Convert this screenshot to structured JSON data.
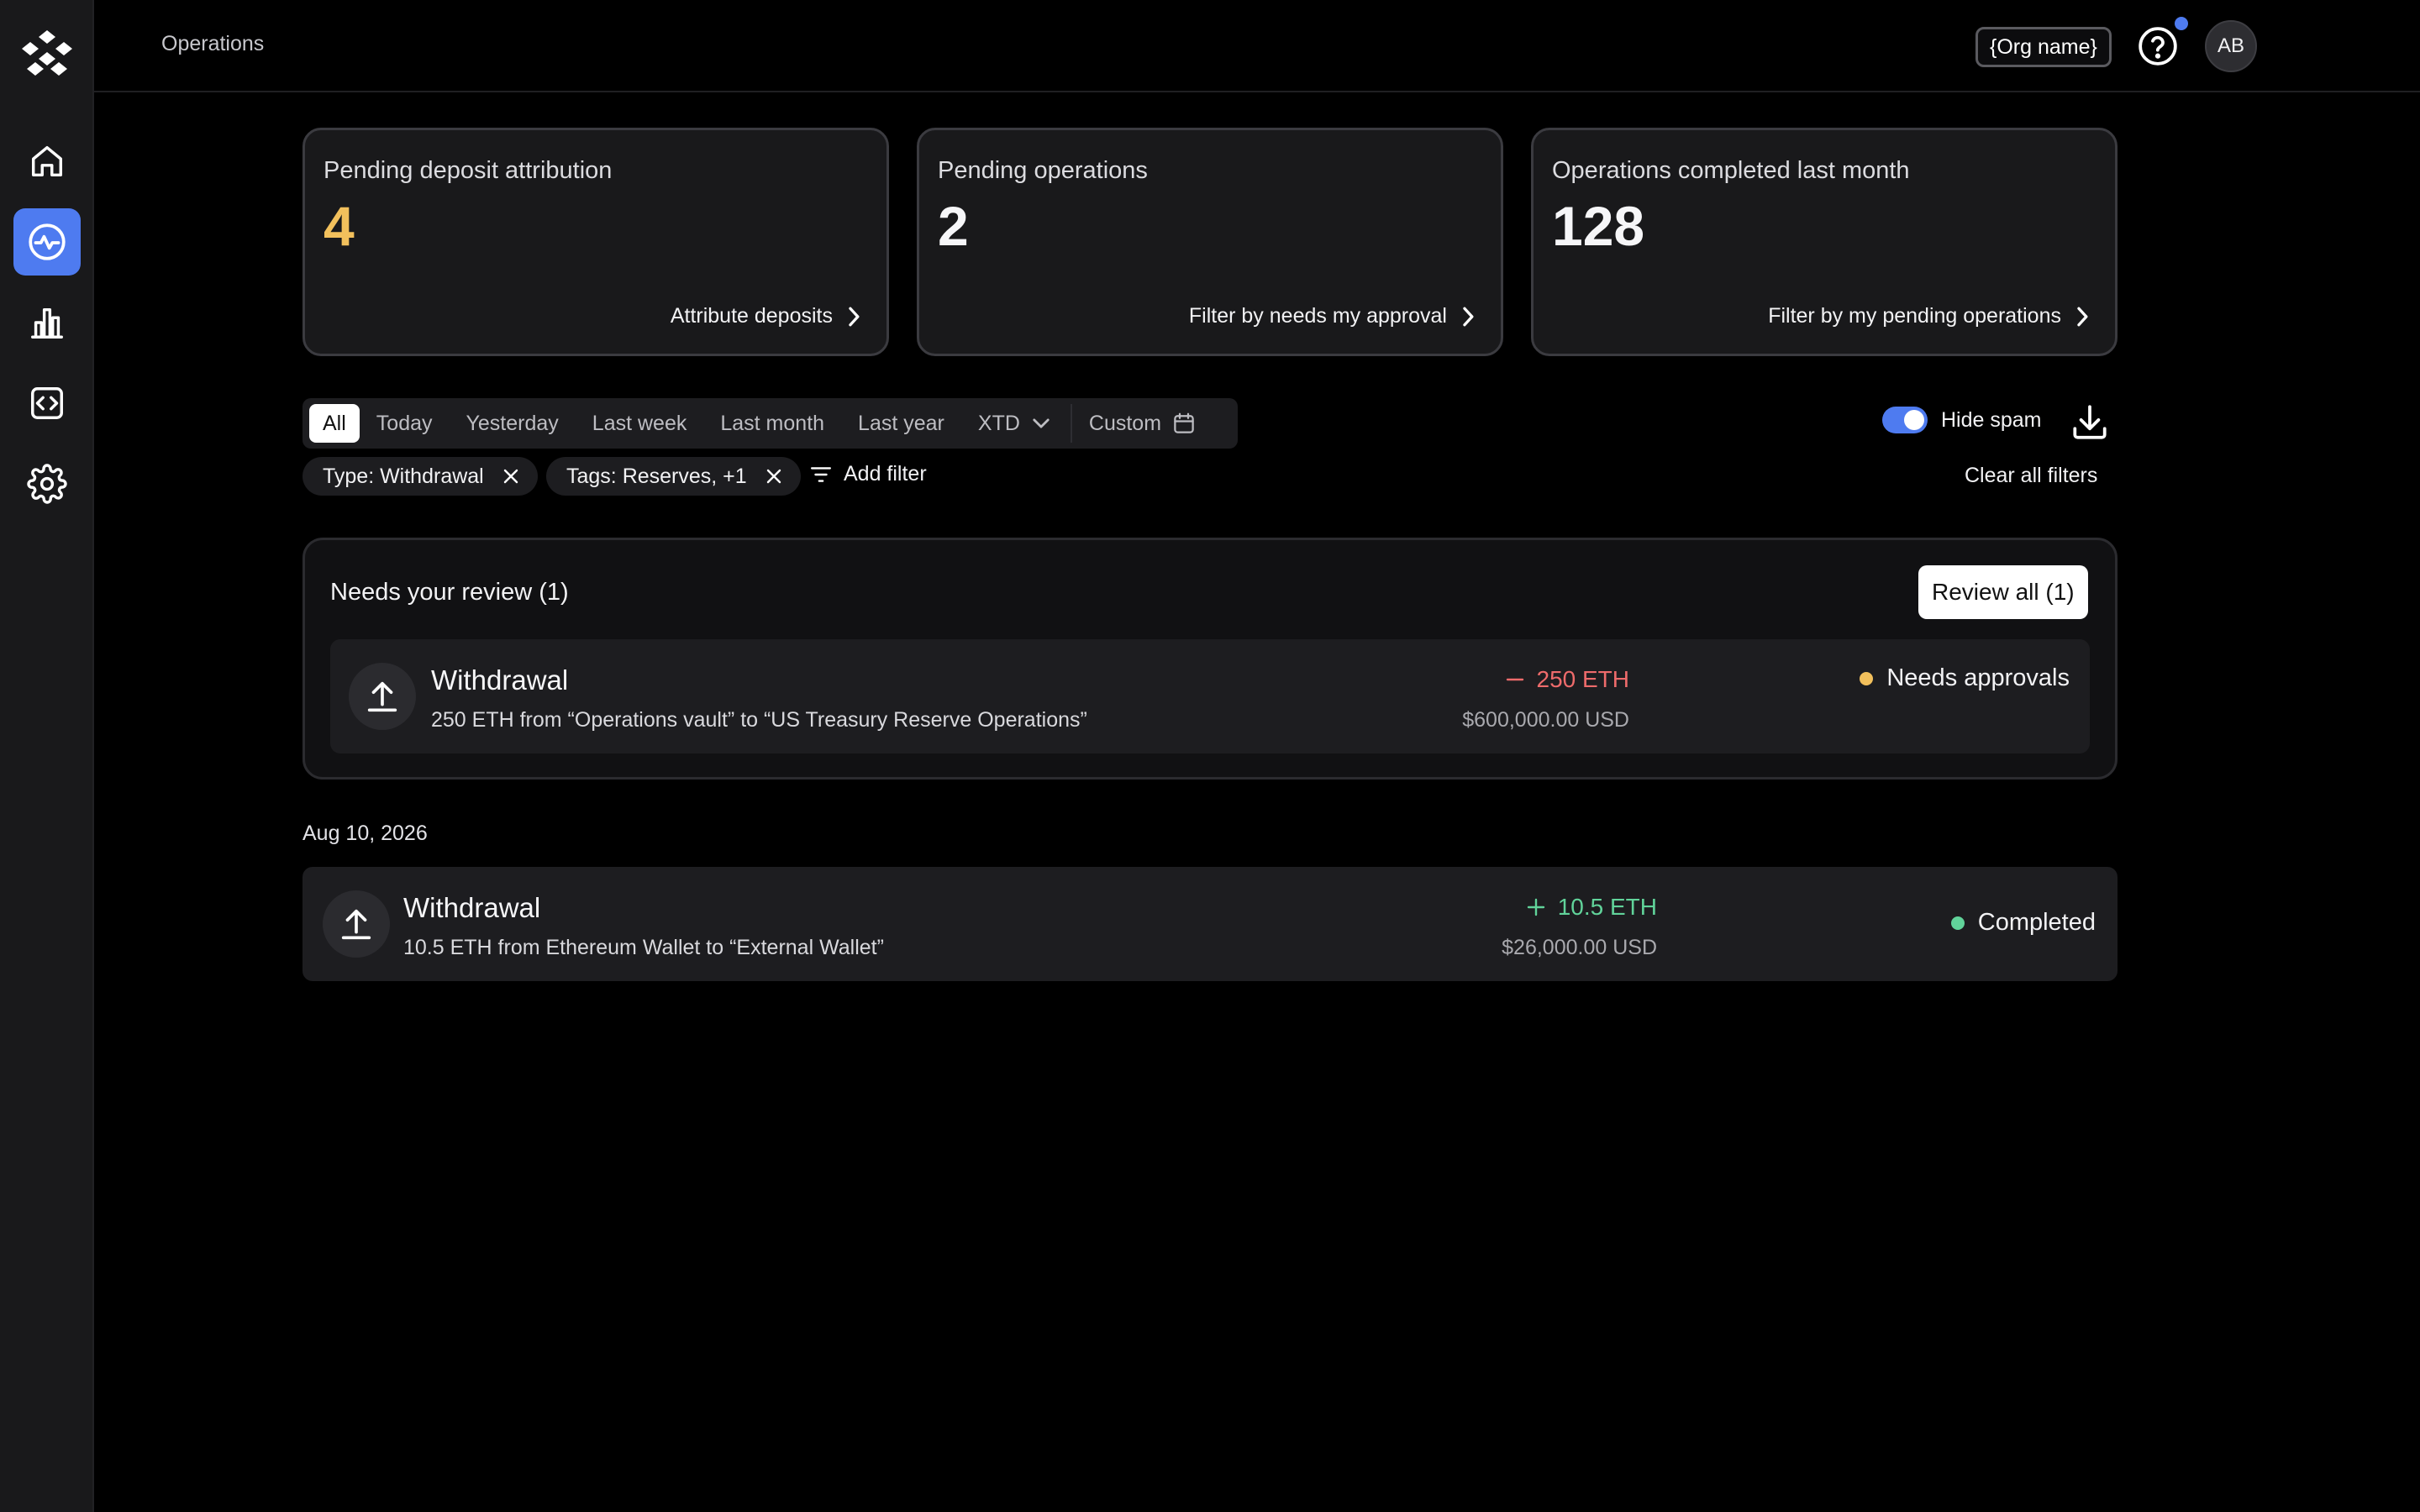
{
  "header": {
    "page_title": "Operations",
    "org_name": "{Org name}",
    "avatar_initials": "AB"
  },
  "sidebar": {
    "items": [
      {
        "name": "home",
        "icon": "home-icon",
        "active": false
      },
      {
        "name": "operations",
        "icon": "activity-icon",
        "active": true
      },
      {
        "name": "analytics",
        "icon": "bar-chart-icon",
        "active": false
      },
      {
        "name": "developer",
        "icon": "code-icon",
        "active": false
      },
      {
        "name": "settings",
        "icon": "gear-icon",
        "active": false
      }
    ]
  },
  "stats": [
    {
      "label": "Pending deposit attribution",
      "value": "4",
      "action": "Attribute deposits"
    },
    {
      "label": "Pending operations",
      "value": "2",
      "action": "Filter by needs my approval"
    },
    {
      "label": "Operations completed last month",
      "value": "128",
      "action": "Filter by my pending operations"
    }
  ],
  "filters": {
    "periods": [
      "All",
      "Today",
      "Yesterday",
      "Last week",
      "Last month",
      "Last year"
    ],
    "xtd_label": "XTD",
    "custom_label": "Custom",
    "active_period": "All",
    "hide_spam_label": "Hide spam",
    "hide_spam_on": true,
    "chips": [
      "Type: Withdrawal",
      "Tags: Reserves, +1"
    ],
    "add_filter_label": "Add filter",
    "clear_all_label": "Clear all filters"
  },
  "review": {
    "title": "Needs your review (1)",
    "review_all_label": "Review all (1)",
    "item": {
      "title": "Withdrawal",
      "description": "250 ETH from “Operations vault” to “US Treasury Reserve Operations”",
      "amount": "250 ETH",
      "usd": "$600,000.00 USD",
      "status": "Needs approvals"
    }
  },
  "history": {
    "date": "Aug 10, 2026",
    "item": {
      "title": "Withdrawal",
      "description": "10.5 ETH from Ethereum Wallet to “External Wallet”",
      "amount": "10.5 ETH",
      "usd": "$26,000.00 USD",
      "status": "Completed"
    }
  },
  "colors": {
    "accent": "#4e7bf0",
    "pending_yellow": "#f2c05c",
    "negative_red": "#ee6b6b",
    "positive_green": "#61d39a"
  }
}
